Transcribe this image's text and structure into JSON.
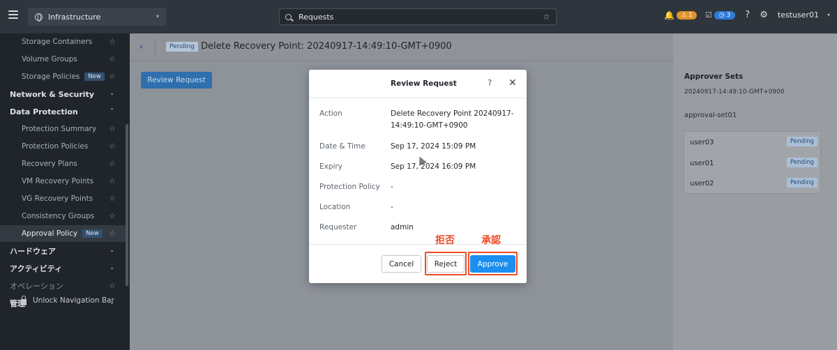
{
  "topbar": {
    "app_name": "Infrastructure",
    "search_value": "Requests",
    "alert_count": "1",
    "task_count": "3",
    "help": "?",
    "user": "testuser01"
  },
  "sidebar": {
    "items": [
      {
        "label": "Storage Containers"
      },
      {
        "label": "Volume Groups"
      },
      {
        "label": "Storage Policies",
        "badge": "New"
      },
      {
        "label": "Network & Security"
      },
      {
        "label": "Data Protection"
      },
      {
        "label": "Protection Summary"
      },
      {
        "label": "Protection Policies"
      },
      {
        "label": "Recovery Plans"
      },
      {
        "label": "VM Recovery Points"
      },
      {
        "label": "VG Recovery Points"
      },
      {
        "label": "Consistency Groups"
      },
      {
        "label": "Approval Policy",
        "badge": "New"
      },
      {
        "label": "ハードウェア"
      },
      {
        "label": "アクティビティ"
      },
      {
        "label": "オペレーション"
      },
      {
        "label": "管理"
      }
    ],
    "unlock_label": "Unlock Navigation Bar"
  },
  "page": {
    "status_tag": "Pending",
    "title": "Delete Recovery Point: 20240917-14:49:10-GMT+0900",
    "review_button": "Review Request"
  },
  "approver_panel": {
    "title": "Approver Sets",
    "subtitle": "20240917-14:49:10-GMT+0900",
    "set_name": "approval-set01",
    "approvers": [
      {
        "user": "user03",
        "status": "Pending"
      },
      {
        "user": "user01",
        "status": "Pending"
      },
      {
        "user": "user02",
        "status": "Pending"
      }
    ]
  },
  "modal": {
    "title": "Review Request",
    "help": "?",
    "close": "✕",
    "fields": [
      {
        "label": "Action",
        "value": "Delete Recovery Point 20240917-14:49:10-GMT+0900"
      },
      {
        "label": "Date & Time",
        "value": "Sep 17, 2024 15:09 PM"
      },
      {
        "label": "Expiry",
        "value": "Sep 17, 2024 16:09 PM"
      },
      {
        "label": "Protection Policy",
        "value": "-"
      },
      {
        "label": "Location",
        "value": "-"
      },
      {
        "label": "Requester",
        "value": "admin"
      }
    ],
    "buttons": {
      "cancel": "Cancel",
      "reject": "Reject",
      "approve": "Approve"
    }
  },
  "annotations": {
    "reject_label": "拒否",
    "approve_label": "承認",
    "color": "#f04a22"
  },
  "colors": {
    "primary": "#1b8ff0",
    "topbar": "#2f353d",
    "sidebar": "#20252b"
  }
}
